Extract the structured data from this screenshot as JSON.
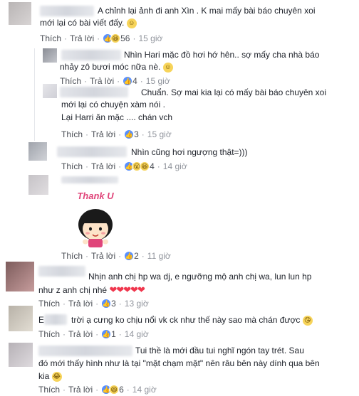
{
  "actions": {
    "like": "Thích",
    "reply": "Trả lời",
    "sep": "·"
  },
  "comments": [
    {
      "text_lines": [
        "A chỉnh lại ảnh đi anh Xìn . K mai mấy bài báo chuyên xoi",
        "mới lại có bài viết đấy."
      ],
      "reactions": [
        "like",
        "haha"
      ],
      "count": "56",
      "time": "15 giờ"
    },
    {
      "text_lines": [
        "Nhìn Hari mặc đồ hơi hớ hên.. sợ mấy cha nhà báo",
        "nhảy zô bươi móc nữa nè."
      ],
      "reactions": [
        "like"
      ],
      "count": "4",
      "time": "15 giờ"
    },
    {
      "text_lines": [
        "Chuẩn. Sợ mai kia lại có mấy bài báo chuyên xoi",
        "mới lại có chuyện xàm nói .",
        "Lại Harri ăn mặc .... chán vch"
      ],
      "reactions": [
        "like"
      ],
      "count": "3",
      "time": "15 giờ"
    },
    {
      "text_lines": [
        "Nhìn cũng hơi ngượng thật=)))"
      ],
      "reactions": [
        "like",
        "wow",
        "haha"
      ],
      "count": "4",
      "time": "14 giờ"
    },
    {
      "sticker_text": "Thank U",
      "reactions": [
        "like"
      ],
      "count": "2",
      "time": "11 giờ"
    },
    {
      "text_lines": [
        "Nhịn anh chị hp wa dj, e ngưỡng mộ anh chị wa, lun lun hp",
        "như z anh chị nhé"
      ],
      "reactions": [
        "like"
      ],
      "count": "3",
      "time": "13 giờ"
    },
    {
      "prefix": "E",
      "text_lines": [
        "trời ạ cưng ko chịu nổi vk ck như thế này sao mà chán được"
      ],
      "reactions": [
        "like"
      ],
      "count": "1",
      "time": "14 giờ"
    },
    {
      "text_lines": [
        "Tui thề là mới đầu tui nghĩ ngón tay trét. Sau",
        "đó mới thấy hình như là tại \"mặt chạm mặt\" nên râu bên này dính qua bên",
        "kia"
      ],
      "reactions": [
        "like",
        "haha"
      ],
      "count": "6",
      "time": "14 giờ"
    }
  ]
}
